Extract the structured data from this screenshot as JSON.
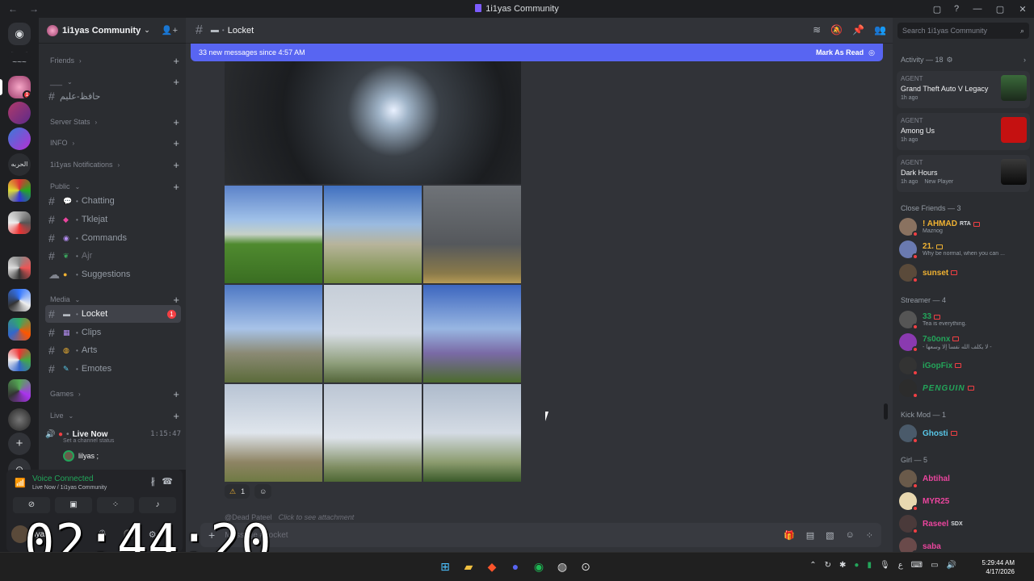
{
  "window": {
    "title": "1i1yas Community",
    "nav": [
      "←",
      "→"
    ],
    "controls": [
      "▢",
      "?",
      "—",
      "▢",
      "✕"
    ]
  },
  "server": {
    "name": "1i1yas Community"
  },
  "categories": [
    {
      "label": "Friends"
    },
    {
      "label": "___"
    },
    {
      "label": "Server Stats"
    },
    {
      "label": "INFO"
    },
    {
      "label": "1i1yas Notifications"
    },
    {
      "label": "Public"
    },
    {
      "label": "Media"
    },
    {
      "label": "Games"
    },
    {
      "label": "Live"
    }
  ],
  "channels": {
    "arabic": "حافظ-علیم",
    "chatting": "Chatting",
    "tklejat": "Tklejat",
    "commands": "Commands",
    "ajr": "Ajr",
    "suggestions": "Suggestions",
    "locket": "Locket",
    "locket_unread": "1",
    "clips": "Clips",
    "arts": "Arts",
    "emotes": "Emotes"
  },
  "live": {
    "name": "Live Now",
    "timer": "1:15:47",
    "status": "Set a channel status",
    "user": "lilyas ;"
  },
  "voice": {
    "status": "Voice Connected",
    "location": "Live Now / 1i1yas Community"
  },
  "user": {
    "name": "ilyas"
  },
  "overlay_clock": "02:44:20",
  "header": {
    "channel": "Locket"
  },
  "newbar": {
    "text": "33 new messages since 4:57 AM",
    "action": "Mark As Read"
  },
  "reactions": [
    {
      "emoji": "⚠",
      "count": "1"
    }
  ],
  "next_message": {
    "author": "@Dead Pateel",
    "text": "Click to see attachment"
  },
  "composer": {
    "placeholder": "Message #Locket"
  },
  "members": {
    "search_placeholder": "Search 1i1yas Community",
    "activity_header": "Activity — 18",
    "activities": [
      {
        "agent": "AGENT",
        "game": "Grand Theft Auto V Legacy",
        "ago": "1h ago"
      },
      {
        "agent": "AGENT",
        "game": "Among Us",
        "ago": "1h ago"
      },
      {
        "agent": "AGENT",
        "game": "Dark Hours",
        "ago": "1h ago",
        "extra": "New Player"
      }
    ],
    "groups": [
      {
        "title": "Close Friends — 3",
        "members": [
          {
            "name": "! AHMAD",
            "sub": "Maznog",
            "color": "#f0b232",
            "tag": "RTA"
          },
          {
            "name": "21.",
            "sub": "Why be normal, when you can ...",
            "color": "#f0b232"
          },
          {
            "name": "sunset",
            "sub": "",
            "color": "#f0b232"
          }
        ]
      },
      {
        "title": "Streamer — 4",
        "members": [
          {
            "name": "33",
            "sub": "Tea is everything.",
            "color": "#23a55a"
          },
          {
            "name": "7s0onx",
            "sub": "- لا يكلف الله نفساً إلا وسعها -",
            "color": "#23a55a"
          },
          {
            "name": "iGopFix",
            "sub": "",
            "color": "#23a55a"
          },
          {
            "name": "PENGUIN",
            "sub": "",
            "color": "#23a55a"
          }
        ]
      },
      {
        "title": "Kick Mod — 1",
        "members": [
          {
            "name": "Ghosti",
            "sub": "",
            "color": "#58c7e8"
          }
        ]
      },
      {
        "title": "Girl — 5",
        "members": [
          {
            "name": "Abtihal",
            "sub": "",
            "color": "#eb459e"
          },
          {
            "name": "MYR25",
            "sub": "",
            "color": "#eb459e"
          },
          {
            "name": "Raseel",
            "sub": "",
            "color": "#eb459e",
            "tag": "SDX"
          },
          {
            "name": "saba",
            "sub": "",
            "color": "#eb459e"
          }
        ]
      }
    ]
  },
  "taskbar": {
    "time": "5:29:44 AM",
    "date": "4/17/2026"
  },
  "colors": {
    "blurple": "#5865f2",
    "red": "#f23f43",
    "green": "#23a55a"
  }
}
